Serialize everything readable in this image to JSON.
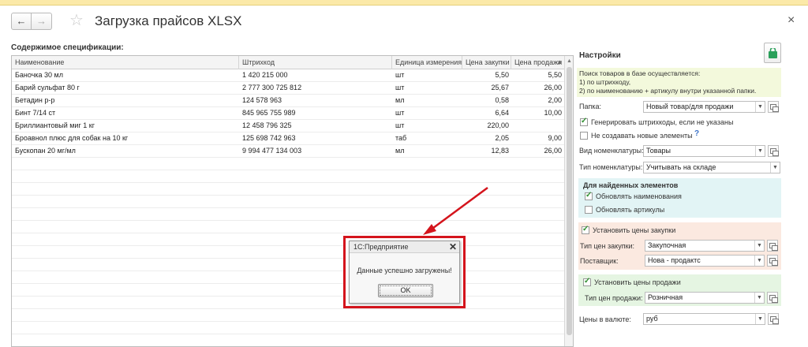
{
  "window": {
    "title": "Загрузка прайсов XLSX",
    "back_glyph": "←",
    "forward_glyph": "→",
    "favorite_glyph": "☆",
    "close_glyph": "×"
  },
  "spec": {
    "label": "Содержимое спецификации:",
    "columns": [
      "Наименование",
      "Штрихкод",
      "Единица измерения",
      "Цена закупки",
      "Цена продажи"
    ],
    "rows": [
      {
        "name": "Баночка 30 мл",
        "barcode": "1 420 215 000",
        "unit": "шт",
        "buy": "5,50",
        "sell": "5,50"
      },
      {
        "name": "Барий сульфат 80 г",
        "barcode": "2 777 300 725 812",
        "unit": "шт",
        "buy": "25,67",
        "sell": "26,00"
      },
      {
        "name": "Бетадин р-р",
        "barcode": "124 578 963",
        "unit": "мл",
        "buy": "0,58",
        "sell": "2,00"
      },
      {
        "name": "Бинт 7/14 ст",
        "barcode": "845 965 755 989",
        "unit": "шт",
        "buy": "6,64",
        "sell": "10,00"
      },
      {
        "name": "Бриллиантовый миг 1 кг",
        "barcode": "12 458 796 325",
        "unit": "шт",
        "buy": "220,00",
        "sell": ""
      },
      {
        "name": "Броавнол плюс для собак на 10 кг",
        "barcode": "125 698 742 963",
        "unit": "таб",
        "buy": "2,05",
        "sell": "9,00"
      },
      {
        "name": "Бускопан 20 мг/мл",
        "barcode": "9 994 477 134 003",
        "unit": "мл",
        "buy": "12,83",
        "sell": "26,00"
      }
    ]
  },
  "dialog": {
    "title": "1С:Предприятие",
    "close_glyph": "✕",
    "message": "Данные успешно загружены!",
    "ok_label": "OK"
  },
  "settings": {
    "title": "Настройки",
    "info_lines": [
      "Поиск товаров в базе осуществляется:",
      "1) по штрихкоду,",
      "2) по наименованию + артикулу внутри указанной папки."
    ],
    "folder_label": "Папка:",
    "folder_value": "Новый товар/для продажи",
    "gen_barcodes_label": "Генерировать штрихкоды, если не указаны",
    "gen_barcodes_checked": true,
    "no_new_label": "Не создавать новые элементы",
    "no_new_checked": false,
    "help_glyph": "?",
    "nom_kind_label": "Вид номенклатуры:",
    "nom_kind_value": "Товары",
    "nom_type_label": "Тип номенклатуры:",
    "nom_type_value": "Учитывать на складе",
    "found_title": "Для найденных элементов",
    "update_names_label": "Обновлять наименования",
    "update_names_checked": true,
    "update_articles_label": "Обновлять артикулы",
    "update_articles_checked": false,
    "set_buy_label": "Установить цены закупки",
    "set_buy_checked": true,
    "buy_price_type_label": "Тип цен закупки:",
    "buy_price_type_value": "Закупочная",
    "supplier_label": "Поставщик:",
    "supplier_value": "Нова - продактс",
    "set_sell_label": "Установить цены продажи",
    "set_sell_checked": true,
    "sell_price_type_label": "Тип цен продажи:",
    "sell_price_type_value": "Розничная",
    "currency_label": "Цены в валюте:",
    "currency_value": "руб"
  },
  "colors": {
    "accent_red": "#d4141c",
    "save_icon_green": "#2aa05a",
    "top_stripe": "#fbe9a8"
  },
  "icons": {
    "save": "save-floppy-icon",
    "dropdown": "chevron-down-icon",
    "open": "open-form-icon"
  }
}
